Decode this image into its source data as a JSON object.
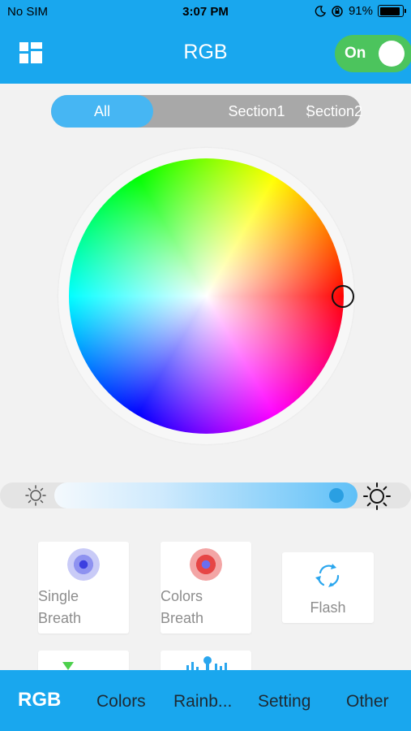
{
  "status_bar": {
    "carrier": "No SIM",
    "time": "3:07 PM",
    "battery": "91%",
    "battery_level": 0.91
  },
  "header": {
    "title": "RGB",
    "power_toggle": "On",
    "menu_icon": "grid-icon"
  },
  "sections": {
    "items": [
      "All",
      "Section1",
      "Section2"
    ],
    "selected": "All"
  },
  "color_wheel": {
    "icon": "color-wheel"
  },
  "brightness": {
    "level": 0.96,
    "min_icon": "sun-small-icon",
    "max_icon": "sun-large-icon"
  },
  "modes": [
    {
      "label_1": "Single",
      "label_2": "Breath",
      "icon": "single-breath-icon"
    },
    {
      "label_1": "Colors",
      "label_2": "Breath",
      "icon": "colors-breath-icon"
    },
    {
      "label": "Flash",
      "icon": "flash-icon"
    }
  ],
  "tabs": {
    "rgb": "RGB",
    "colors": "Colors",
    "rainbow": "Rainb...",
    "setting": "Setting",
    "other": "Other"
  },
  "colors": {
    "accent": "#19a7ee",
    "toggle_on": "#4cc45d",
    "segment_active": "#46b6f3"
  }
}
